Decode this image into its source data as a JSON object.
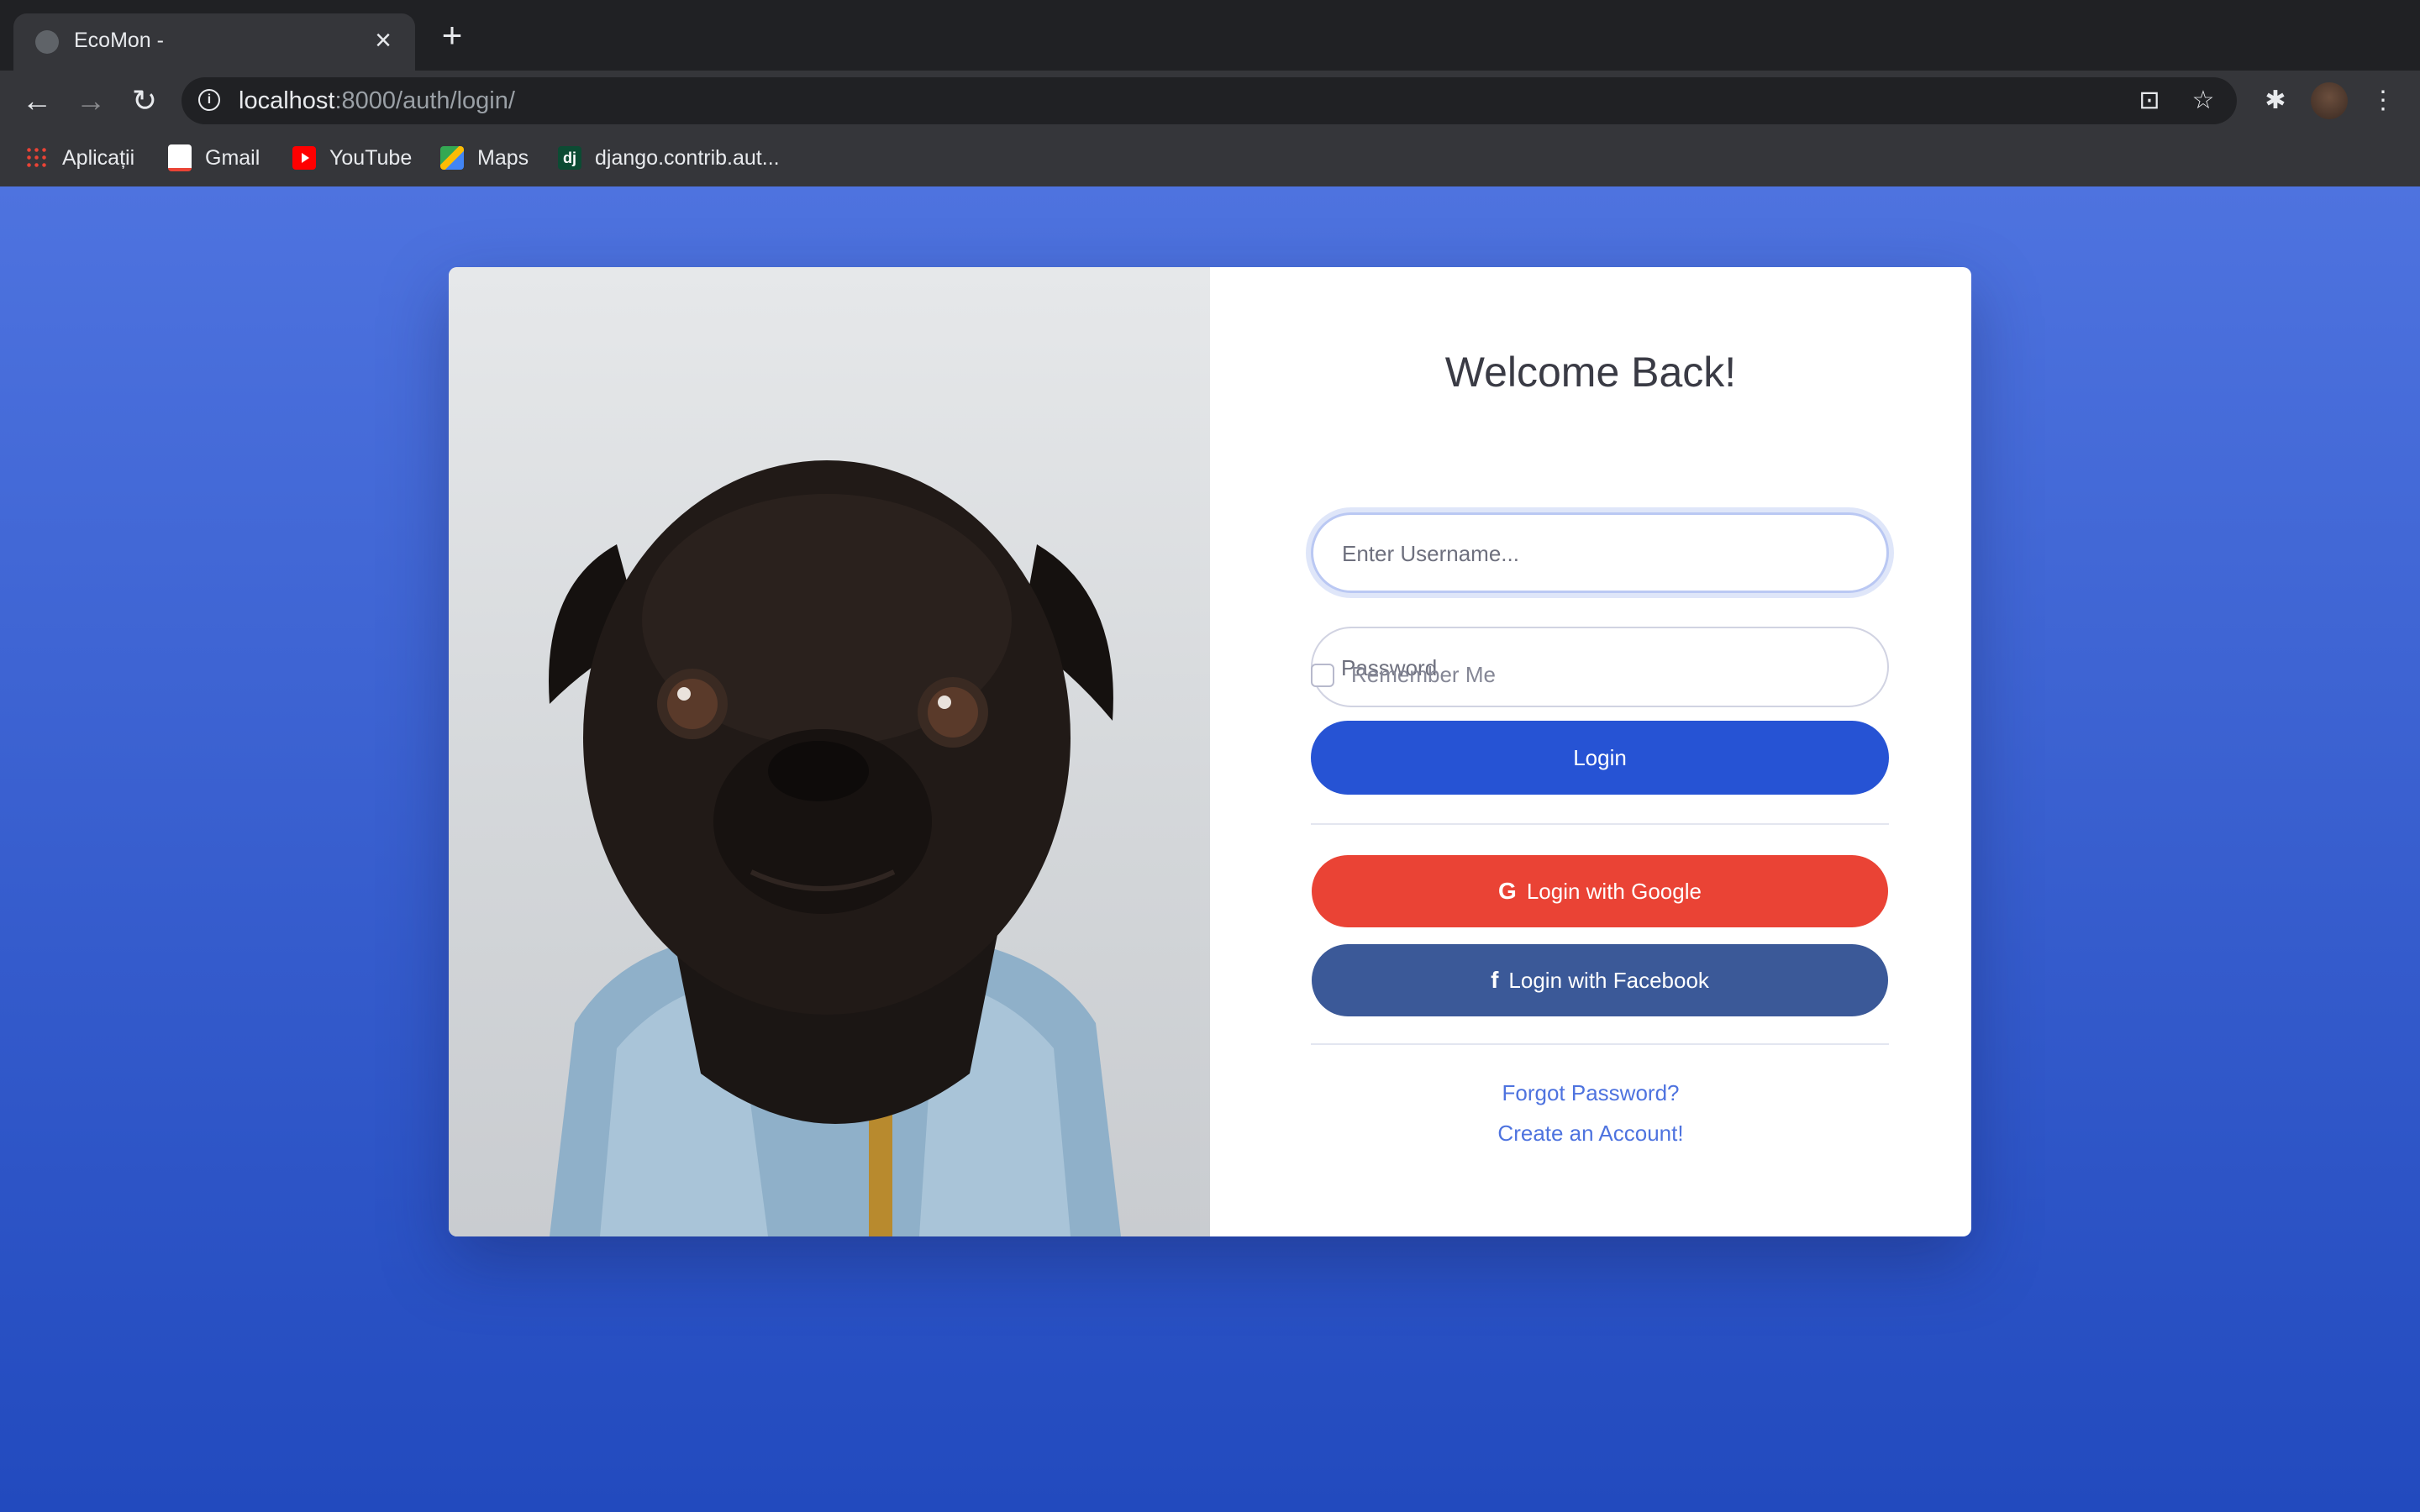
{
  "browser": {
    "tab_title": "EcoMon -",
    "tab_close": "×",
    "new_tab": "+",
    "url_host": "localhost",
    "url_rest": ":8000/auth/login/",
    "info_glyph": "i",
    "back": "←",
    "forward": "→",
    "reload": "↻",
    "translate": "⊡",
    "star": "☆",
    "extensions": "✱",
    "menu": "⋮"
  },
  "bookmarks": [
    {
      "label": "Aplicații",
      "icon": "apps-icon"
    },
    {
      "label": "Gmail",
      "icon": "gmail-icon"
    },
    {
      "label": "YouTube",
      "icon": "youtube-icon"
    },
    {
      "label": "Maps",
      "icon": "maps-icon"
    },
    {
      "label": "django.contrib.aut...",
      "icon": "django-icon",
      "icon_text": "dj"
    }
  ],
  "login": {
    "heading": "Welcome Back!",
    "username_placeholder": "Enter Username...",
    "password_placeholder": "Password",
    "remember_label": "Remember Me",
    "login_button": "Login",
    "google_button": "Login with Google",
    "google_icon_glyph": "G",
    "facebook_button": "Login with Facebook",
    "facebook_icon_glyph": "f",
    "forgot_link": "Forgot Password?",
    "create_link": "Create an Account!"
  },
  "colors": {
    "page_gradient_top": "#4e73df",
    "page_gradient_bottom": "#224abe",
    "login_button": "#2653d4",
    "google": "#ea4335",
    "facebook": "#3b5998",
    "link": "#4e73df"
  }
}
